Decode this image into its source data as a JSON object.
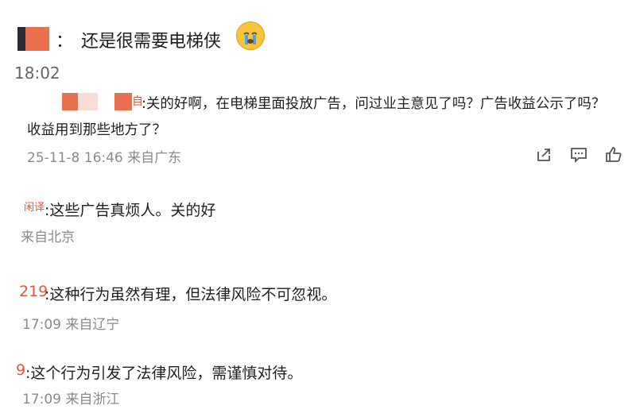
{
  "post": {
    "separator": "：",
    "text": "还是很需要电梯侠",
    "time": "18:02"
  },
  "comments": [
    {
      "username_partial": "自",
      "text": ":关的好啊，在电梯里面投放广告，问过业主意见了吗？广告收益公示了吗？",
      "text_line2": "收益用到那些地方了？",
      "meta": "25-11-8 16:46 来自广东"
    },
    {
      "username_partial": "闲译",
      "text": ":这些广告真烦人。关的好",
      "meta": "来自北京"
    },
    {
      "username_partial": "219",
      "text": ":这种行为虽然有理，但法律风险不可忽视。",
      "meta": "17:09 来自辽宁"
    },
    {
      "username_partial": "9",
      "text": ":这个行为引发了法律风险，需谨慎对待。",
      "meta": "17:09 来自浙江"
    }
  ],
  "actions": {
    "icons": [
      "share-icon",
      "comment-icon",
      "like-icon"
    ]
  },
  "colors": {
    "username": "#e2573b",
    "meta": "#8a8a8a",
    "censor_orange": "#e8704f",
    "censor_light": "#f7ddd5"
  }
}
